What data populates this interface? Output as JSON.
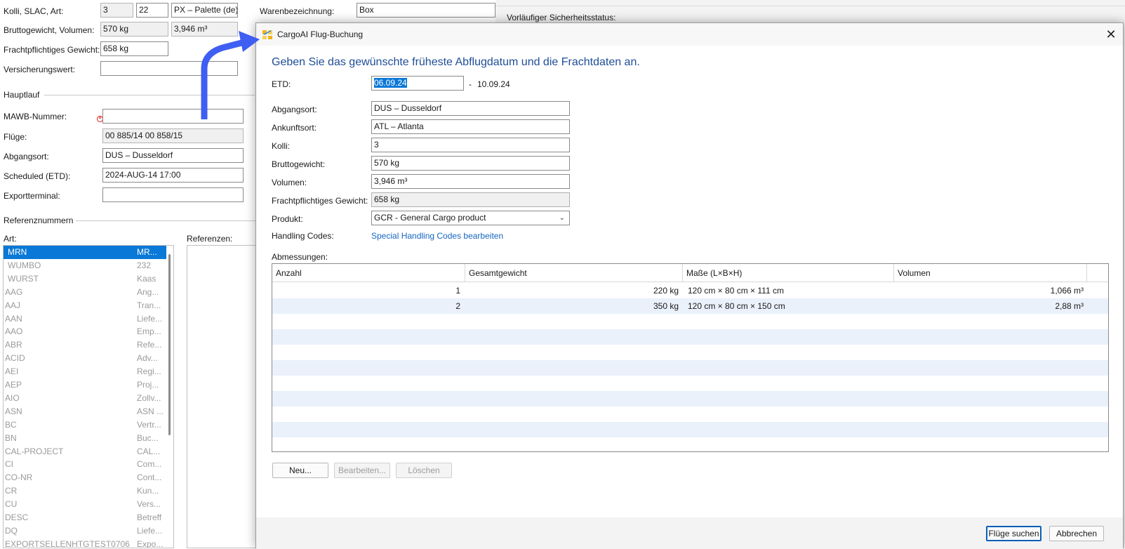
{
  "background_form": {
    "kolli_label": "Kolli, SLAC, Art:",
    "kolli": "3",
    "slac": "22",
    "art": "PX – Palette (de)",
    "brutto_label": "Bruttogewicht, Volumen:",
    "brutto": "570 kg",
    "volumen": "3,946 m³",
    "fracht_label": "Frachtpflichtiges Gewicht:",
    "fracht": "658 kg",
    "versicherung_label": "Versicherungswert:",
    "versicherung": "",
    "waren_label": "Warenbezeichnung:",
    "waren": "Box",
    "sicherheit_label": "Vorläufiger Sicherheitsstatus:",
    "hauptlauf_section": "Hauptlauf",
    "mawb_label": "MAWB-Nummer:",
    "mawb": "",
    "fluege_label": "Flüge:",
    "fluege": "00 885/14 00 858/15",
    "abgangsort_label": "Abgangsort:",
    "abgangsort": "DUS – Dusseldorf",
    "scheduled_label": "Scheduled (ETD):",
    "scheduled": "2024-AUG-14 17:00",
    "exportterminal_label": "Exportterminal:",
    "exportterminal": "",
    "referenz_section": "Referenznummern",
    "art_col_label": "Art:",
    "referenzen_label": "Referenzen:",
    "ref_list": [
      {
        "code": "MRN",
        "desc": "MR..."
      },
      {
        "code": "WUMBO",
        "desc": "232"
      },
      {
        "code": "WURST",
        "desc": "Kaas"
      },
      {
        "code": "AAG",
        "desc": "Ang..."
      },
      {
        "code": "AAJ",
        "desc": "Tran..."
      },
      {
        "code": "AAN",
        "desc": "Liefe..."
      },
      {
        "code": "AAO",
        "desc": "Emp..."
      },
      {
        "code": "ABR",
        "desc": "Refe..."
      },
      {
        "code": "ACID",
        "desc": "Adv..."
      },
      {
        "code": "AEI",
        "desc": "Regi..."
      },
      {
        "code": "AEP",
        "desc": "Proj..."
      },
      {
        "code": "AIO",
        "desc": "Zollv..."
      },
      {
        "code": "ASN",
        "desc": "ASN ..."
      },
      {
        "code": "BC",
        "desc": "Vertr..."
      },
      {
        "code": "BN",
        "desc": "Buc..."
      },
      {
        "code": "CAL-PROJECT",
        "desc": "CAL..."
      },
      {
        "code": "CI",
        "desc": "Com..."
      },
      {
        "code": "CO-NR",
        "desc": "Cont..."
      },
      {
        "code": "CR",
        "desc": "Kun..."
      },
      {
        "code": "CU",
        "desc": "Vers..."
      },
      {
        "code": "DESC",
        "desc": "Betreff"
      },
      {
        "code": "DQ",
        "desc": "Liefe..."
      },
      {
        "code": "EXPORTSELLENHTGTEST0706",
        "desc": "Expo..."
      }
    ]
  },
  "dialog": {
    "title": "CargoAI Flug-Buchung",
    "heading": "Geben Sie das gewünschte früheste Abflugdatum und die Frachtdaten an.",
    "etd_label": "ETD:",
    "etd_from": "06.09.24",
    "etd_sep": "-",
    "etd_to": "10.09.24",
    "abgangsort_label": "Abgangsort:",
    "abgangsort": "DUS – Dusseldorf",
    "ankunftsort_label": "Ankunftsort:",
    "ankunftsort": "ATL – Atlanta",
    "kolli_label": "Kolli:",
    "kolli": "3",
    "brutto_label": "Bruttogewicht:",
    "brutto": "570 kg",
    "volumen_label": "Volumen:",
    "volumen": "3,946 m³",
    "fracht_label": "Frachtpflichtiges Gewicht:",
    "fracht": "658 kg",
    "produkt_label": "Produkt:",
    "produkt": "GCR - General Cargo product",
    "handling_label": "Handling Codes:",
    "handling_link": "Special Handling Codes bearbeiten",
    "abmessungen_label": "Abmessungen:",
    "table": {
      "headers": [
        "Anzahl",
        "Gesamtgewicht",
        "Maße (L×B×H)",
        "Volumen"
      ],
      "rows": [
        {
          "anzahl": "1",
          "gewicht": "220 kg",
          "masse": "120 cm × 80 cm × 111 cm",
          "volumen": "1,066 m³"
        },
        {
          "anzahl": "2",
          "gewicht": "350 kg",
          "masse": "120 cm × 80 cm × 150 cm",
          "volumen": "2,88 m³"
        }
      ]
    },
    "btn_neu": "Neu...",
    "btn_bearbeiten": "Bearbeiten...",
    "btn_loeschen": "Löschen",
    "btn_suchen": "Flüge suchen",
    "btn_abbrechen": "Abbrechen",
    "colors": {
      "heading": "#1f4e96",
      "link": "#1565c0",
      "selection": "#0a78d7",
      "arrow": "#3f5ef2"
    }
  }
}
